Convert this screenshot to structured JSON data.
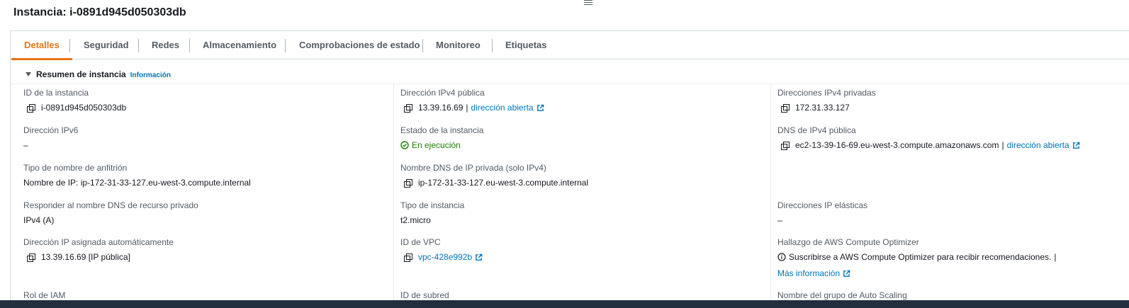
{
  "page": {
    "title": "Instancia: i-0891d945d050303db"
  },
  "tabs": [
    {
      "label": "Detalles",
      "active": true
    },
    {
      "label": "Seguridad"
    },
    {
      "label": "Redes"
    },
    {
      "label": "Almacenamiento"
    },
    {
      "label": "Comprobaciones de estado"
    },
    {
      "label": "Monitoreo"
    },
    {
      "label": "Etiquetas"
    }
  ],
  "summary": {
    "title": "Resumen de instancia",
    "info_link": "Información"
  },
  "fields": {
    "instance_id": {
      "label": "ID de la instancia",
      "value": "i-0891d945d050303db"
    },
    "public_ipv4": {
      "label": "Dirección IPv4 pública",
      "value": "13.39.16.69",
      "separator": "|",
      "link": "dirección abierta"
    },
    "private_ipv4": {
      "label": "Direcciones IPv4 privadas",
      "value": "172.31.33.127"
    },
    "ipv6": {
      "label": "Dirección IPv6",
      "value": "–"
    },
    "instance_state": {
      "label": "Estado de la instancia",
      "value": "En ejecución"
    },
    "public_dns": {
      "label": "DNS de IPv4 pública",
      "value": "ec2-13-39-16-69.eu-west-3.compute.amazonaws.com",
      "separator": "|",
      "link": "dirección abierta"
    },
    "hostname_type": {
      "label": "Tipo de nombre de anfitrión",
      "value": "Nombre de IP: ip-172-31-33-127.eu-west-3.compute.internal"
    },
    "private_dns": {
      "label": "Nombre DNS de IP privada (solo IPv4)",
      "value": "ip-172-31-33-127.eu-west-3.compute.internal"
    },
    "resource_dns": {
      "label": "Responder al nombre DNS de recurso privado",
      "value": "IPv4 (A)"
    },
    "instance_type": {
      "label": "Tipo de instancia",
      "value": "t2.micro"
    },
    "elastic_ip": {
      "label": "Direcciones IP elásticas",
      "value": "–"
    },
    "auto_ip": {
      "label": "Dirección IP asignada automáticamente",
      "value": "13.39.16.69 [IP pública]"
    },
    "vpc_id": {
      "label": "ID de VPC",
      "value": "vpc-428e992b"
    },
    "optimizer": {
      "label": "Hallazgo de AWS Compute Optimizer",
      "value": "Suscribirse a AWS Compute Optimizer para recibir recomendaciones.",
      "separator": "|",
      "link": "Más información"
    },
    "iam_role": {
      "label": "Rol de IAM"
    },
    "subnet_id": {
      "label": "ID de subred"
    },
    "asg_name": {
      "label": "Nombre del grupo de Auto Scaling"
    }
  },
  "icons": {
    "copy": "copy-icon",
    "external": "external-link-icon",
    "status_ok": "check-circle-icon",
    "info": "info-icon"
  },
  "colors": {
    "accent": "#ec7211",
    "link": "#0073bb",
    "success": "#1d8102",
    "text": "#16191f",
    "label": "#545b64"
  }
}
